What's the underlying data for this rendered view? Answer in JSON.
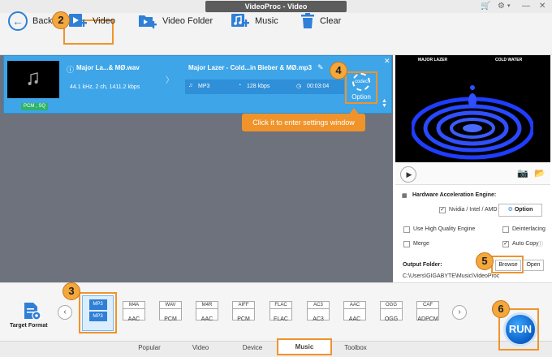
{
  "window": {
    "title": "VideoProc - Video"
  },
  "toolbar": {
    "back": "Back",
    "video": "Video",
    "video_folder": "Video Folder",
    "music": "Music",
    "clear": "Clear"
  },
  "media_item": {
    "source_name": "Major La...& MØ.wav",
    "source_info": "44.1 kHz, 2 ch, 1411.2 kbps",
    "output_name": "Major Lazer - Cold...in Bieber & MØ.mp3",
    "output_format": "MP3",
    "output_bitrate": "128 kbps",
    "output_duration": "00:03:04",
    "codec_chip": "PCM , SQ",
    "codec_icon_text": "codec",
    "option_label": "Option"
  },
  "tooltip": "Click it to enter settings window",
  "preview": {
    "left_text": "MAJOR LAZER",
    "right_text": "COLD WATER"
  },
  "settings": {
    "hw_title": "Hardware Acceleration Engine:",
    "nvidia": "Nvidia / Intel / AMD",
    "option": "Option",
    "high_quality": "Use High Quality Engine",
    "deinterlacing": "Deinterlacing",
    "merge": "Merge",
    "auto_copy": "Auto Copy",
    "output_folder_label": "Output Folder:",
    "output_path": "C:\\Users\\GIGABYTE\\Music\\VideoProc",
    "browse": "Browse",
    "open": "Open"
  },
  "target_format": "Target Format",
  "formats": [
    {
      "top": "MP3",
      "bottom": "MP3",
      "label": "MP3"
    },
    {
      "top": "M4A",
      "bottom": "",
      "label": "AAC"
    },
    {
      "top": "WAV",
      "bottom": "",
      "label": "PCM"
    },
    {
      "top": "M4R",
      "bottom": "",
      "label": "AAC"
    },
    {
      "top": "AIFF",
      "bottom": "",
      "label": "PCM"
    },
    {
      "top": "FLAC",
      "bottom": "",
      "label": "FLAC"
    },
    {
      "top": "AC3",
      "bottom": "",
      "label": "AC3"
    },
    {
      "top": "AAC",
      "bottom": "",
      "label": "AAC"
    },
    {
      "top": "OGG",
      "bottom": "",
      "label": "OGG"
    },
    {
      "top": "CAF",
      "bottom": "",
      "label": "ADPCM"
    }
  ],
  "tabs": [
    "Popular",
    "Video",
    "Device",
    "Music",
    "Toolbox"
  ],
  "run": "RUN",
  "step_badges": [
    "2",
    "3",
    "4",
    "5",
    "6"
  ],
  "colors": {
    "accent": "#3ea5e8",
    "highlight": "#f0932b",
    "run": "#0b5fc7"
  }
}
